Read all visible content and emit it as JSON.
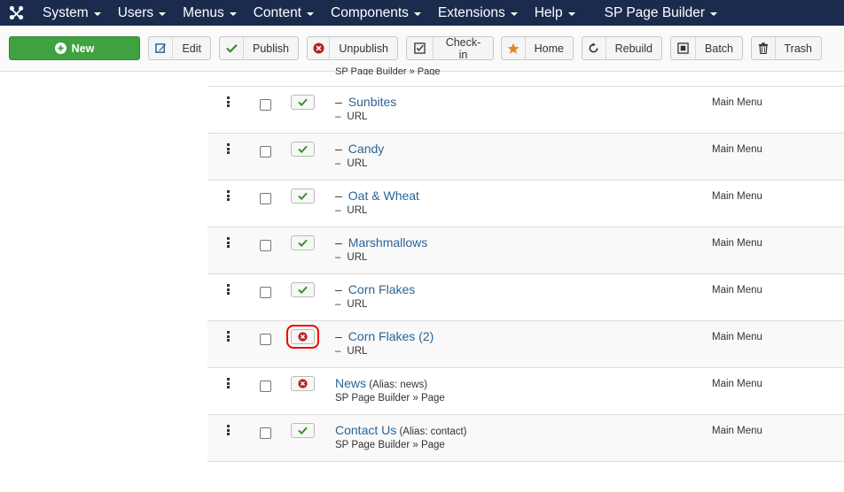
{
  "nav": {
    "items": [
      {
        "label": "System"
      },
      {
        "label": "Users"
      },
      {
        "label": "Menus"
      },
      {
        "label": "Content"
      },
      {
        "label": "Components"
      },
      {
        "label": "Extensions"
      },
      {
        "label": "Help"
      },
      {
        "label": "SP Page Builder"
      }
    ]
  },
  "toolbar": {
    "new": "New",
    "edit": "Edit",
    "publish": "Publish",
    "unpublish": "Unpublish",
    "checkin": "Check-in",
    "home": "Home",
    "rebuild": "Rebuild",
    "batch": "Batch",
    "trash": "Trash"
  },
  "colors": {
    "navbar": "#1a2b4d",
    "new_button": "#3fa13f",
    "published": "#3c8d2f",
    "unpublished": "#b32424",
    "link": "#2a6496"
  },
  "top_fragment": "SP Page Builder » Page",
  "rows": [
    {
      "title": "Sunbites",
      "alias": "",
      "dash": "–",
      "type": "URL",
      "menu": "Main Menu",
      "status": "published"
    },
    {
      "title": "Candy",
      "alias": "",
      "dash": "–",
      "type": "URL",
      "menu": "Main Menu",
      "status": "published"
    },
    {
      "title": "Oat & Wheat",
      "alias": "",
      "dash": "–",
      "type": "URL",
      "menu": "Main Menu",
      "status": "published"
    },
    {
      "title": "Marshmallows",
      "alias": "",
      "dash": "–",
      "type": "URL",
      "menu": "Main Menu",
      "status": "published"
    },
    {
      "title": "Corn Flakes",
      "alias": "",
      "dash": "–",
      "type": "URL",
      "menu": "Main Menu",
      "status": "published"
    },
    {
      "title": "Corn Flakes (2)",
      "alias": "",
      "dash": "–",
      "type": "URL",
      "menu": "Main Menu",
      "status": "unpublished"
    },
    {
      "title": "News",
      "alias": "(Alias: news)",
      "dash": "",
      "type": "SP Page Builder » Page",
      "menu": "Main Menu",
      "status": "unpublished"
    },
    {
      "title": "Contact Us",
      "alias": "(Alias: contact)",
      "dash": "",
      "type": "SP Page Builder » Page",
      "menu": "Main Menu",
      "status": "published"
    }
  ]
}
